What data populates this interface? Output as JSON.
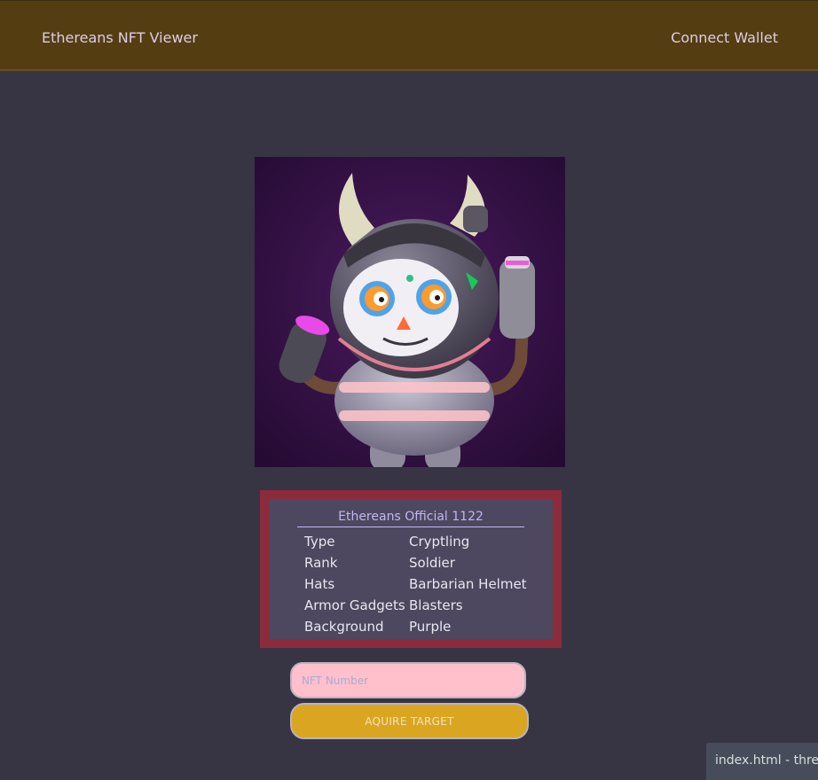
{
  "navbar": {
    "brand": "Ethereans NFT Viewer",
    "wallet_label": "Connect Wallet"
  },
  "nft": {
    "title": "Ethereans Official 1122",
    "traits": [
      {
        "key": "Type",
        "value": "Cryptling"
      },
      {
        "key": "Rank",
        "value": "Soldier"
      },
      {
        "key": "Hats",
        "value": "Barbarian Helmet"
      },
      {
        "key": "Armor Gadgets",
        "value": "Blasters"
      },
      {
        "key": "Background",
        "value": "Purple"
      }
    ]
  },
  "form": {
    "input_placeholder": "NFT Number",
    "button_label": "AQUIRE TARGET"
  },
  "statusbar": {
    "text": "index.html - three"
  },
  "colors": {
    "navbar": "#553d12",
    "background": "#373444",
    "card_border": "#8c2b3b",
    "card_bg": "#4d4860",
    "input_bg": "#ffc0cb",
    "button_bg": "#daa520",
    "title_accent": "#c2b5f0"
  }
}
